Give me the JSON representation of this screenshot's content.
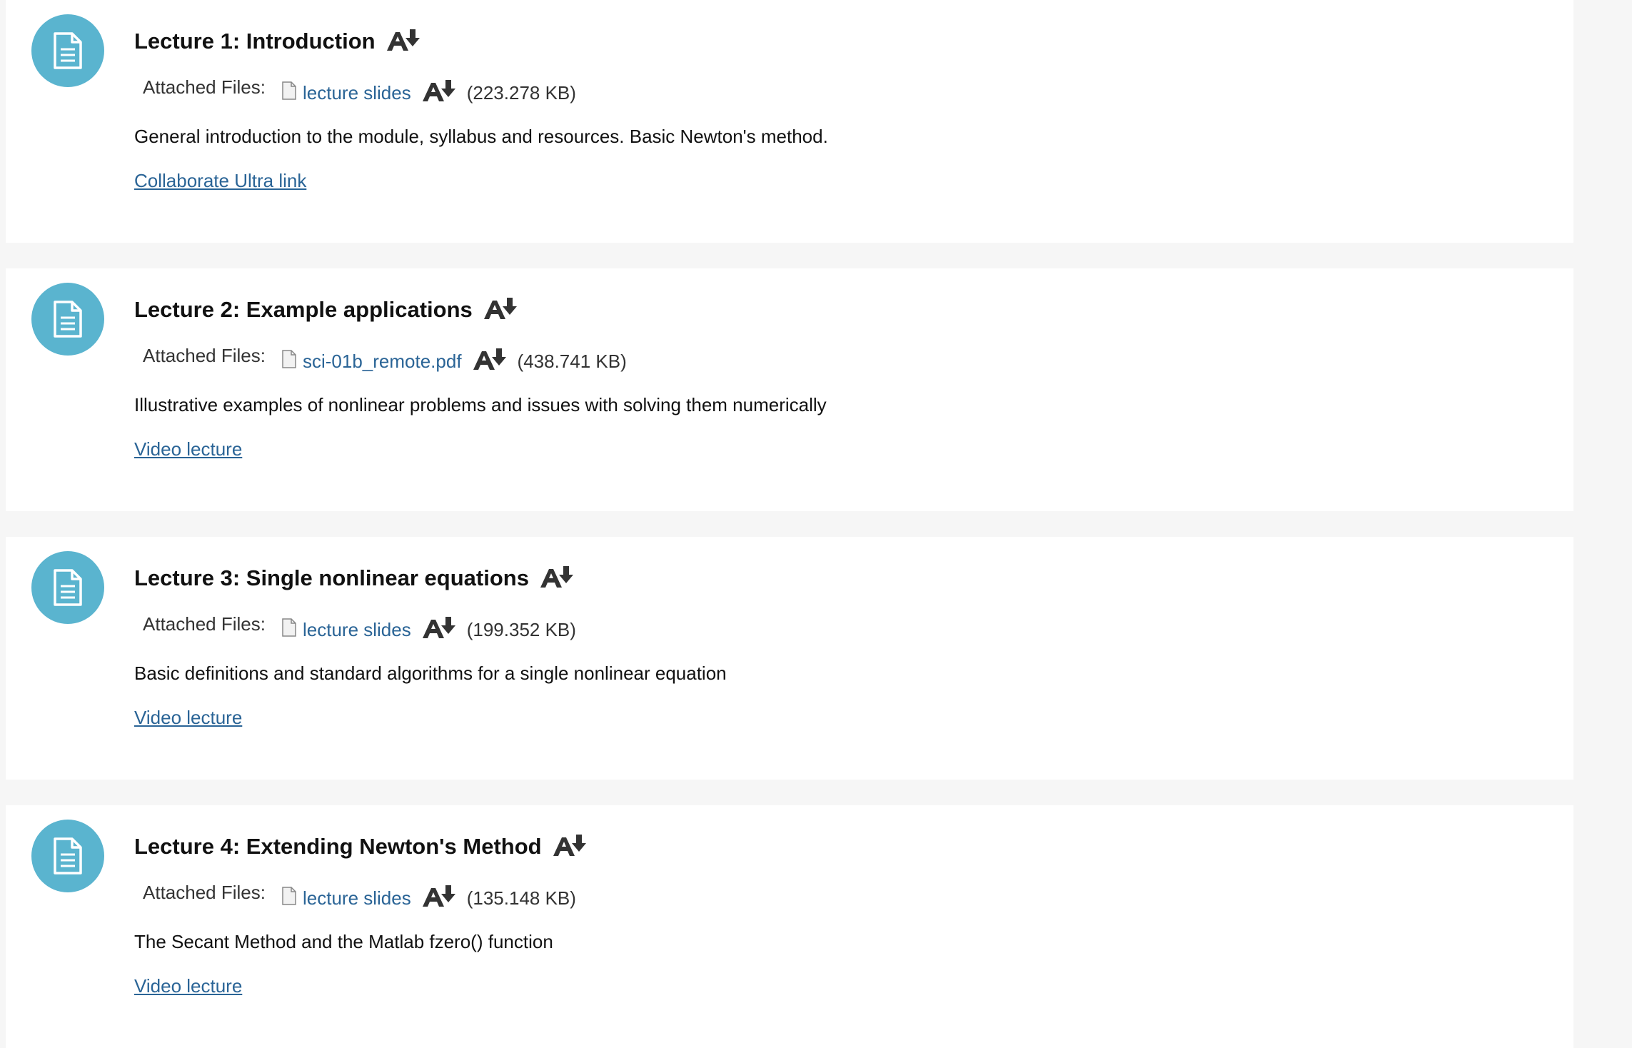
{
  "items": [
    {
      "title": "Lecture 1: Introduction",
      "files_label": "Attached Files:",
      "file_name": "lecture slides",
      "file_size": "(223.278 KB)",
      "description": "General introduction to the module, syllabus and resources. Basic Newton's method.",
      "link": "Collaborate Ultra link"
    },
    {
      "title": "Lecture 2: Example applications",
      "files_label": "Attached Files:",
      "file_name": "sci-01b_remote.pdf",
      "file_size": "(438.741 KB)",
      "description": "Illustrative examples of nonlinear problems and issues with solving them numerically",
      "link": "Video lecture"
    },
    {
      "title": "Lecture 3: Single nonlinear equations",
      "files_label": "Attached Files:",
      "file_name": "lecture slides",
      "file_size": "(199.352 KB)",
      "description": "Basic definitions and standard algorithms for a single nonlinear equation",
      "link": "Video lecture"
    },
    {
      "title": "Lecture 4: Extending Newton's Method",
      "files_label": "Attached Files:",
      "file_name": "lecture slides",
      "file_size": "(135.148 KB)",
      "description": "The Secant Method and the Matlab fzero() function",
      "link": "Video lecture"
    }
  ],
  "icons": {
    "item_icon": "document-icon",
    "reader_icon": "alternative-formats-icon",
    "file_icon": "file-icon"
  },
  "colors": {
    "item_icon_bg": "#5ab4cf",
    "link": "#2a6496",
    "page_bg": "#f6f6f6"
  }
}
